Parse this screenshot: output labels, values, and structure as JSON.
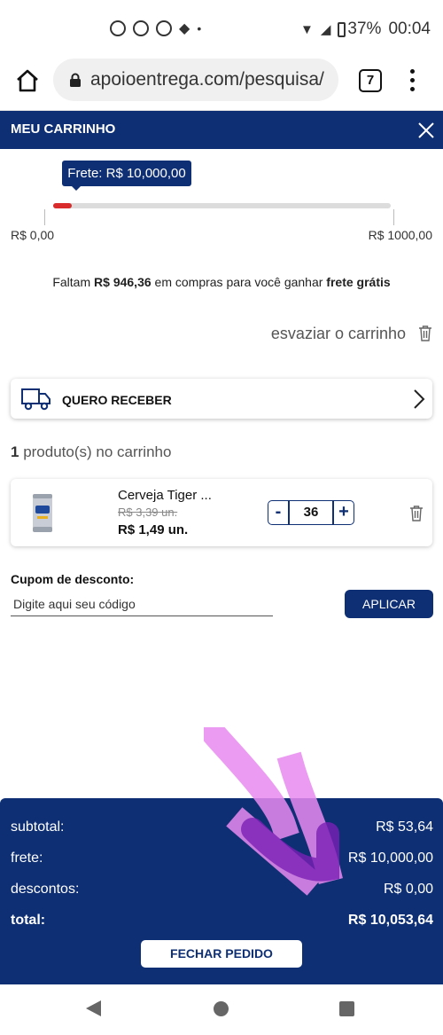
{
  "status_bar": {
    "battery": "37%",
    "time": "00:04"
  },
  "browser": {
    "url": "apoioentrega.com/pesquisa/",
    "tab_count": "7"
  },
  "cart": {
    "title": "MEU CARRINHO",
    "freight_badge": "Frete: R$ 10,000,00",
    "progress": {
      "min_label": "R$ 0,00",
      "max_label": "R$ 1000,00",
      "fill_fraction": 0.054
    },
    "remaining": {
      "prefix": "Faltam ",
      "amount": "R$ 946,36",
      "middle": " em compras para você ganhar ",
      "bold_end": "frete grátis"
    },
    "clear_label": "esvaziar o carrinho",
    "delivery_label": "QUERO RECEBER",
    "product_count": {
      "number": "1",
      "text": " produto(s) no carrinho"
    },
    "product": {
      "name": "Cerveja Tiger ...",
      "old_price": "R$ 3,39 un.",
      "price": "R$ 1,49 un.",
      "quantity": "36",
      "minus": "-",
      "plus": "+"
    },
    "coupon": {
      "label": "Cupom de desconto:",
      "placeholder": "Digite aqui seu código",
      "apply_label": "APLICAR"
    },
    "totals": {
      "subtotal_label": "subtotal:",
      "subtotal_value": "R$ 53,64",
      "frete_label": "frete:",
      "frete_value": "R$ 10,000,00",
      "descontos_label": "descontos:",
      "descontos_value": "R$ 0,00",
      "total_label": "total:",
      "total_value": "R$ 10,053,64"
    },
    "checkout_label": "FECHAR PEDIDO"
  },
  "colors": {
    "primary": "#0e2f73",
    "progress_fill": "#d92b2b",
    "scribble_light": "#e98af0",
    "scribble_dark": "#7a1fb5"
  }
}
